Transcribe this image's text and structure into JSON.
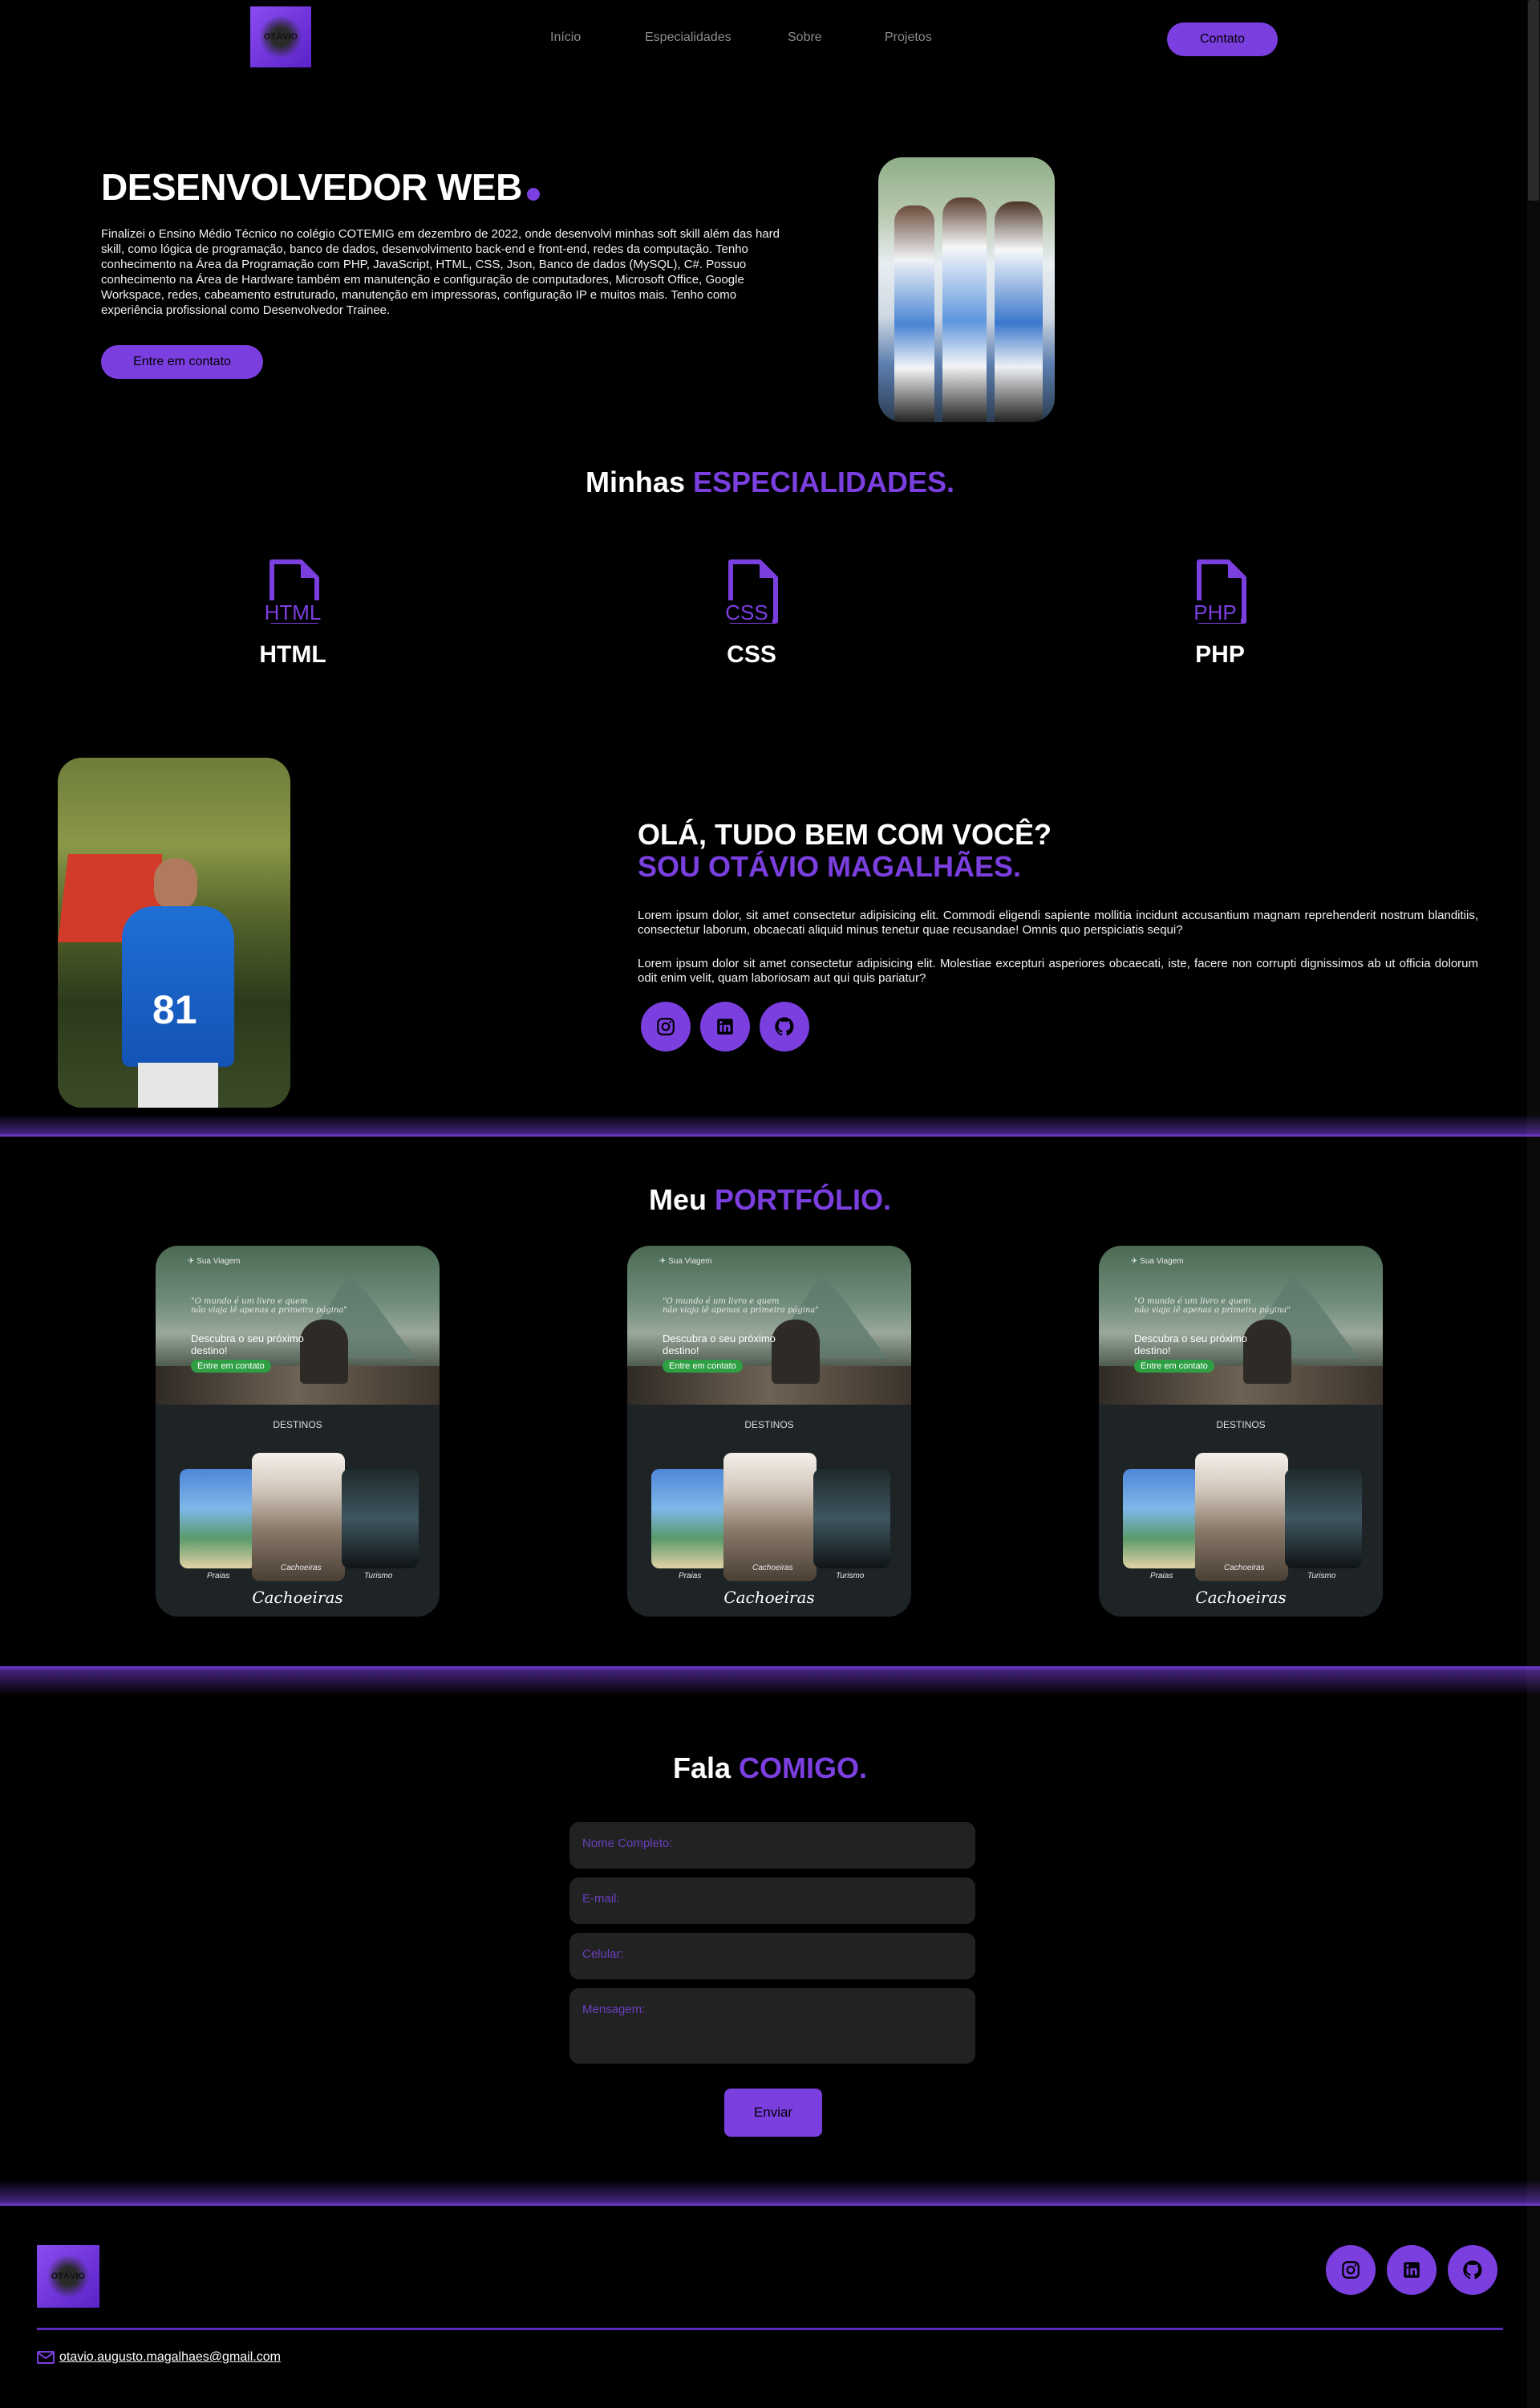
{
  "header": {
    "logo_text": "OTÁVIO",
    "nav": [
      "Início",
      "Especialidades",
      "Sobre",
      "Projetos"
    ],
    "contact_button": "Contato"
  },
  "hero": {
    "title": "DESENVOLVEDOR WEB",
    "text": "Finalizei o Ensino Médio Técnico no colégio COTEMIG em dezembro de 2022, onde desenvolvi minhas soft skill além das hard skill, como lógica de programação, banco de dados, desenvolvimento back-end e front-end, redes da computação. Tenho conhecimento na Área da Programação com PHP, JavaScript, HTML, CSS, Json, Banco de dados (MySQL), C#. Possuo conhecimento na Área de Hardware também em manutenção e configuração de computadores, Microsoft Office, Google Workspace, redes, cabeamento estruturado, manutenção em impressoras, configuração IP e muitos mais. Tenho como experiência profissional como Desenvolvedor Trainee.",
    "cta": "Entre em contato"
  },
  "specialties": {
    "title_prefix": "Minhas",
    "title_highlight": "ESPECIALIDADES.",
    "items": [
      {
        "icon_text": "HTML",
        "label": "HTML"
      },
      {
        "icon_text": "CSS",
        "label": "CSS"
      },
      {
        "icon_text": "PHP",
        "label": "PHP"
      }
    ]
  },
  "about": {
    "heading_line1": "OLÁ, TUDO BEM COM VOCÊ?",
    "heading_line2": "SOU OTÁVIO MAGALHÃES.",
    "p1": "Lorem ipsum dolor, sit amet consectetur adipisicing elit. Commodi eligendi sapiente mollitia incidunt accusantium magnam reprehenderit nostrum blanditiis, consectetur laborum, obcaecati aliquid minus tenetur quae recusandae! Omnis quo perspiciatis sequi?",
    "p2": "Lorem ipsum dolor sit amet consectetur adipisicing elit. Molestiae excepturi asperiores obcaecati, iste, facere non corrupti dignissimos ab ut officia dolorum odit enim velit, quam laboriosam aut qui quis pariatur?"
  },
  "portfolio": {
    "title_prefix": "Meu",
    "title_highlight": "PORTFÓLIO.",
    "card": {
      "brand": "Sua Viagem",
      "quote_line1": "\"O mundo é um livro e quem",
      "quote_line2": "não viaja lê apenas a primeira página\"",
      "headline_line1": "Descubra o seu próximo",
      "headline_line2": "destino!",
      "button": "Entre em contato",
      "section": "DESTINOS",
      "tiles": [
        "Praias",
        "Cachoeiras",
        "Turismo"
      ],
      "footer_title": "Cachoeiras"
    }
  },
  "contact": {
    "title_prefix": "Fala",
    "title_highlight": "COMIGO.",
    "placeholders": [
      "Nome Completo:",
      "E-mail:",
      "Celular:",
      "Mensagem:"
    ],
    "submit": "Enviar"
  },
  "footer": {
    "email": "otavio.augusto.magalhaes@gmail.com"
  },
  "colors": {
    "accent": "#7b3fe0",
    "background": "#000000",
    "field": "#222222"
  }
}
